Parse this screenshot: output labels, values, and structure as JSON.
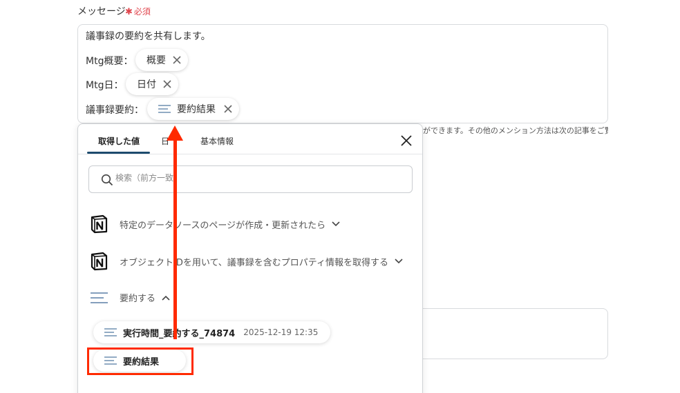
{
  "field": {
    "label": "メッセージ",
    "required_star": "✱",
    "required_text": "必須"
  },
  "message": {
    "line1": "議事録の要約を共有します。",
    "line2_label": "Mtg概要：",
    "line2_chip": "概要",
    "line3_label": "Mtg日：",
    "line3_chip": "日付",
    "line4_label": "議事録要約：",
    "line4_chip": "要約結果"
  },
  "hint_text": "ができます。その他のメンション方法は次の記事をご覧く",
  "panel": {
    "tabs": [
      "取得した値",
      "日",
      "基本情報"
    ],
    "active_tab": 0,
    "search_placeholder": "検索（前方一致",
    "sections": [
      {
        "label": "特定のデータソースのページが作成・更新されたら",
        "icon": "notion-icon",
        "expanded": false
      },
      {
        "label": "オブジェクトIDを用いて、議事録を含むプロパティ情報を取得する",
        "icon": "notion-icon",
        "expanded": false
      },
      {
        "label": "要約する",
        "icon": "lines-icon",
        "expanded": true
      }
    ],
    "items": [
      {
        "label": "実行時間_要約する_74874",
        "date": "2025-12-19 12:35"
      },
      {
        "label": "要約結果"
      }
    ]
  },
  "colors": {
    "accent_underline": "#1d4b6e",
    "required_red": "#e0454d",
    "annotation_red": "#ff2a00",
    "lines_icon_blue": "#6e8fb0"
  }
}
